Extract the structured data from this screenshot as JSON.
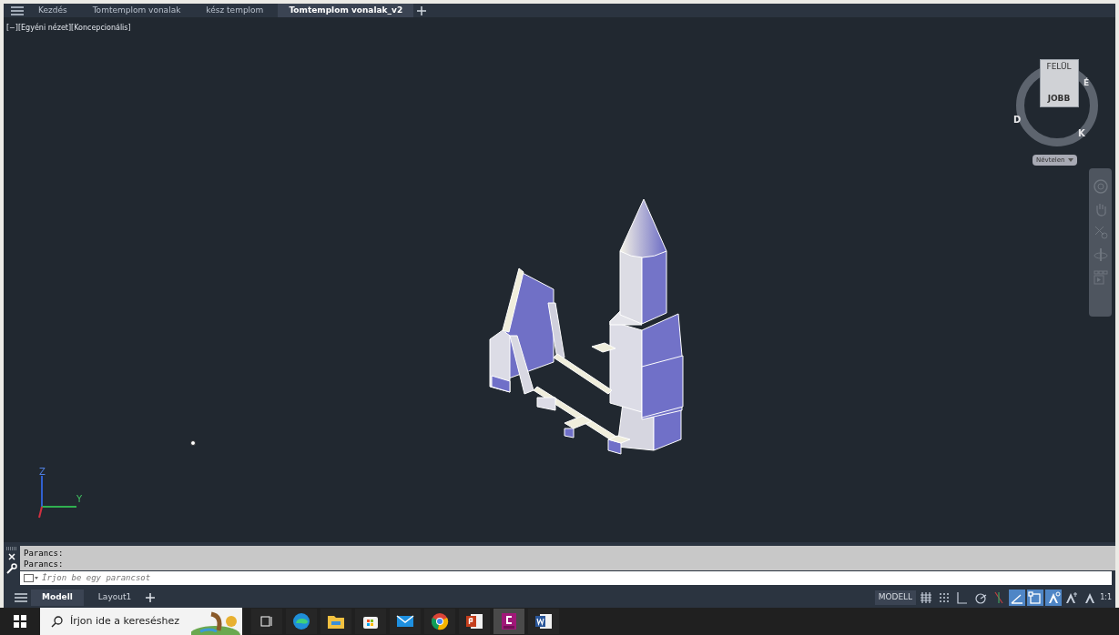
{
  "file_tabs": [
    {
      "label": "Kezdés",
      "selected": false
    },
    {
      "label": "Tomtemplom vonalak",
      "selected": false
    },
    {
      "label": "kész templom",
      "selected": false
    },
    {
      "label": "Tomtemplom vonalak_v2",
      "selected": true
    }
  ],
  "viewport": {
    "label": "[−][Egyéni nézet][Koncepcionális]",
    "viewcube": {
      "top_face": "FELÜL",
      "front_face": "JOBB",
      "compass": [
        "É",
        "K",
        "D"
      ],
      "view_menu": "Névtelen"
    },
    "ucs": {
      "z": "Z",
      "y": "Y"
    }
  },
  "command_line": {
    "history": [
      "Parancs:",
      "Parancs:"
    ],
    "placeholder": "Írjon be egy parancsot"
  },
  "layout_tabs": [
    {
      "label": "Modell",
      "selected": true
    },
    {
      "label": "Layout1",
      "selected": false
    }
  ],
  "status_bar": {
    "space": "MODELL",
    "scale": "1:1",
    "toggles": [
      {
        "kind": "grid",
        "on": false
      },
      {
        "kind": "snap",
        "on": false
      },
      {
        "kind": "ortho",
        "on": false
      },
      {
        "kind": "polar",
        "on": false
      },
      {
        "kind": "isodraft",
        "on": false
      },
      {
        "kind": "dynucs",
        "on": true
      },
      {
        "kind": "osnap",
        "on": true
      },
      {
        "kind": "annovis",
        "on": true
      },
      {
        "kind": "autoscale",
        "on": false
      },
      {
        "kind": "annoscale",
        "on": false
      }
    ]
  },
  "taskbar": {
    "search_placeholder": "Írjon ide a kereséshez",
    "apps": [
      {
        "kind": "taskview",
        "selected": false
      },
      {
        "kind": "edge",
        "selected": false
      },
      {
        "kind": "explorer",
        "selected": false
      },
      {
        "kind": "store",
        "selected": false
      },
      {
        "kind": "mail",
        "selected": false
      },
      {
        "kind": "chrome",
        "selected": false
      },
      {
        "kind": "powerpoint",
        "selected": false
      },
      {
        "kind": "autocad",
        "selected": true
      },
      {
        "kind": "word",
        "selected": false
      }
    ]
  }
}
